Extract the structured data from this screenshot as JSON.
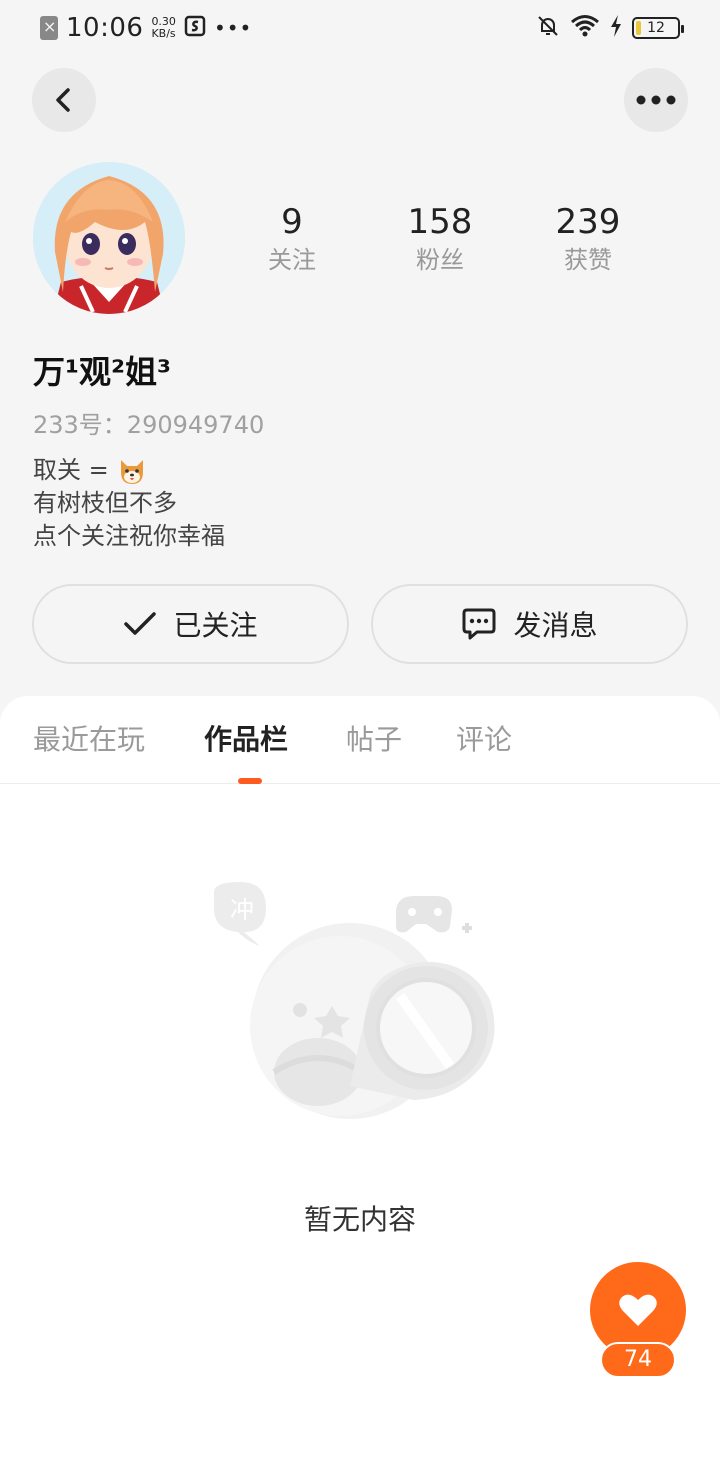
{
  "status_bar": {
    "time": "10:06",
    "speed_value": "0.30",
    "speed_unit": "KB/s",
    "battery": "12",
    "battery_level": 0.12
  },
  "profile": {
    "stats": [
      {
        "value": "9",
        "label": "关注"
      },
      {
        "value": "158",
        "label": "粉丝"
      },
      {
        "value": "239",
        "label": "获赞"
      }
    ],
    "username": "万¹观²姐³",
    "uid": "233号：290949740",
    "bio": [
      "取关 =",
      "有树枝但不多",
      "点个关注祝你幸福"
    ]
  },
  "actions": {
    "follow_label": "已关注",
    "message_label": "发消息"
  },
  "tabs": [
    {
      "label": "最近在玩",
      "active": false
    },
    {
      "label": "作品栏",
      "active": true
    },
    {
      "label": "帖子",
      "active": false
    },
    {
      "label": "评论",
      "active": false
    }
  ],
  "empty_state": {
    "bubble_text": "冲",
    "text": "暂无内容"
  },
  "like_button": {
    "count": "74"
  },
  "colors": {
    "accent": "#ff6a1a",
    "tab_indicator": "#ff5a1f",
    "background": "#f5f5f5"
  }
}
